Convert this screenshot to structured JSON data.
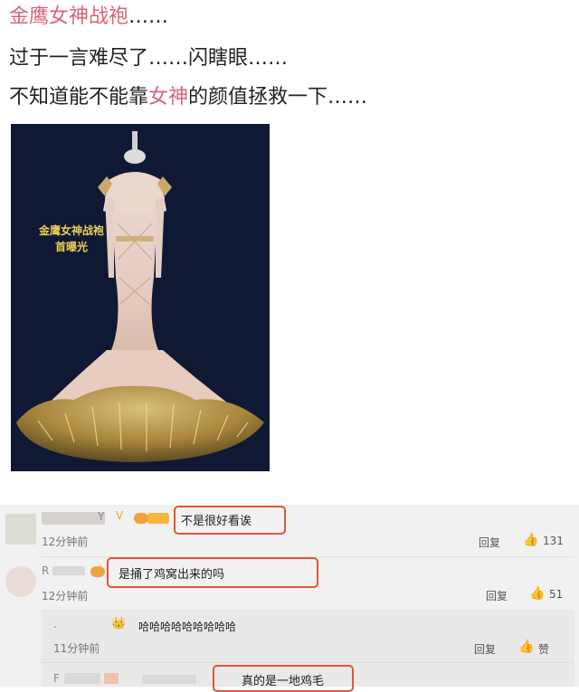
{
  "post": {
    "line1_pink": "金鹰女神战袍",
    "line1_rest": "……",
    "line2": "过于一言难尽了……闪瞎眼……",
    "line3_a": "不知道能不能靠",
    "line3_pink": "女神",
    "line3_b": "的颜值拯救一下……",
    "image_caption_1": "金鹰女神战袍",
    "image_caption_2": "首曝光"
  },
  "comments": [
    {
      "name": "Y",
      "vip": "V",
      "text": "不是很好看诶",
      "time": "12分钟前",
      "reply_label": "回复",
      "like_count": "131"
    },
    {
      "name": "R",
      "text": "是捅了鸡窝出来的吗",
      "time": "12分钟前",
      "reply_label": "回复",
      "like_count": "51"
    },
    {
      "name": ".",
      "text": "哈哈哈哈哈哈哈哈哈",
      "time": "11分钟前",
      "reply_label": "回复",
      "like_label": "赞"
    },
    {
      "name": "F",
      "text": "真的是一地鸡毛"
    }
  ],
  "icons": {
    "thumb": "👍",
    "crown": "👑"
  },
  "colors": {
    "pink": "#d9627a",
    "highlight": "#e3543b"
  }
}
